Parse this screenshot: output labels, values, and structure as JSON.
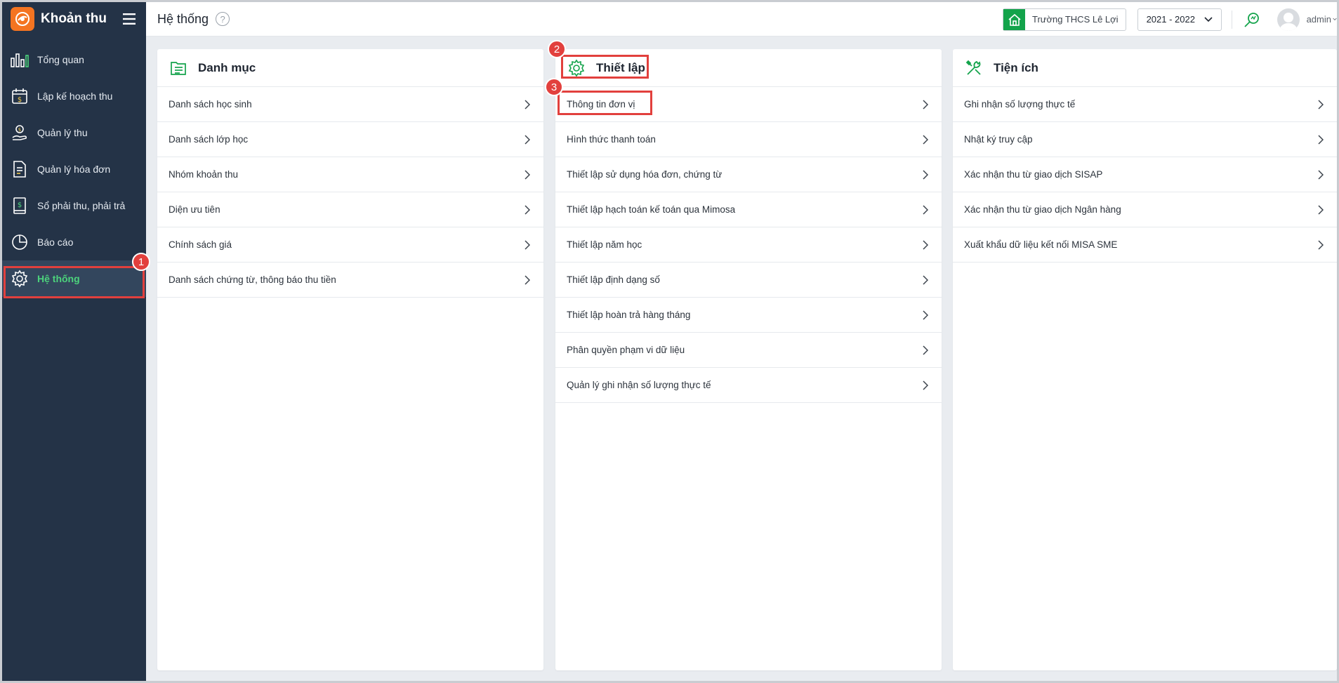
{
  "app": {
    "title": "Khoản thu"
  },
  "sidebar": {
    "items": [
      {
        "label": "Tổng quan",
        "icon": "bar-chart-icon"
      },
      {
        "label": "Lập kế hoạch thu",
        "icon": "calendar-dollar-icon"
      },
      {
        "label": "Quản lý thu",
        "icon": "money-hand-icon"
      },
      {
        "label": "Quản lý hóa đơn",
        "icon": "invoice-icon"
      },
      {
        "label": "Sổ phải thu, phải trả",
        "icon": "ledger-icon"
      },
      {
        "label": "Báo cáo",
        "icon": "pie-chart-icon"
      },
      {
        "label": "Hệ thống",
        "icon": "gear-icon",
        "active": true
      }
    ]
  },
  "header": {
    "title": "Hệ thống",
    "help": "?",
    "school": "Trường THCS Lê Lợi",
    "year": "2021 - 2022",
    "user": "admin"
  },
  "panels": {
    "catalog": {
      "title": "Danh mục",
      "items": [
        "Danh sách học sinh",
        "Danh sách lớp học",
        "Nhóm khoản thu",
        "Diện ưu tiên",
        "Chính sách giá",
        "Danh sách chứng từ, thông báo thu tiền"
      ]
    },
    "settings": {
      "title": "Thiết lập",
      "items": [
        "Thông tin đơn vị",
        "Hình thức thanh toán",
        "Thiết lập sử dụng hóa đơn, chứng từ",
        "Thiết lập hạch toán kế toán qua Mimosa",
        "Thiết lập năm học",
        "Thiết lập định dạng số",
        "Thiết lập hoàn trả hàng tháng",
        "Phân quyền phạm vi dữ liệu",
        "Quản lý ghi nhận số lượng thực tế"
      ]
    },
    "utilities": {
      "title": "Tiện ích",
      "items": [
        "Ghi nhận số lượng thực tế",
        "Nhật ký truy cập",
        "Xác nhận thu từ giao dịch SISAP",
        "Xác nhận thu từ giao dịch Ngân hàng",
        "Xuất khẩu dữ liệu kết nối MISA SME"
      ]
    }
  },
  "annotations": {
    "step1": "1",
    "step2": "2",
    "step3": "3"
  },
  "colors": {
    "sidebar_bg": "#243347",
    "accent_green": "#13a34b",
    "active_text": "#4cd37c",
    "annotation_red": "#e2403d",
    "brand_orange": "#f47421"
  }
}
